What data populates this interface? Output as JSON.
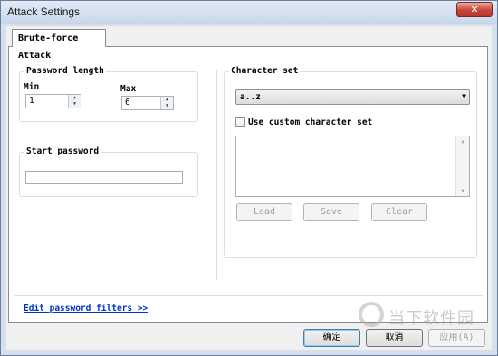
{
  "window": {
    "title": "Attack Settings",
    "close_glyph": "✕"
  },
  "tabs": [
    {
      "label": "Brute-force Attack",
      "selected": true
    }
  ],
  "password_length": {
    "group_title": "Password length",
    "min_label": "Min",
    "min_value": "1",
    "max_label": "Max",
    "max_value": "6"
  },
  "start_password": {
    "group_title": "Start password",
    "value": ""
  },
  "character_set": {
    "group_title": "Character set",
    "selected": "a..z",
    "custom_label": "Use custom character set",
    "custom_checked": false,
    "custom_text": ""
  },
  "charset_buttons": {
    "load": "Load",
    "save": "Save",
    "clear": "Clear"
  },
  "footer": {
    "filters_link": "Edit password filters >>"
  },
  "dialog_buttons": {
    "ok": "确定",
    "cancel": "取消",
    "apply": "应用(A)"
  },
  "watermark": {
    "text": "当下软件园"
  },
  "icons": {
    "close": "close-icon",
    "spin_up": "spin-up-icon",
    "spin_down": "spin-down-icon",
    "dropdown": "chevron-down-icon",
    "scroll_up": "scroll-up-icon",
    "scroll_down": "scroll-down-icon"
  }
}
